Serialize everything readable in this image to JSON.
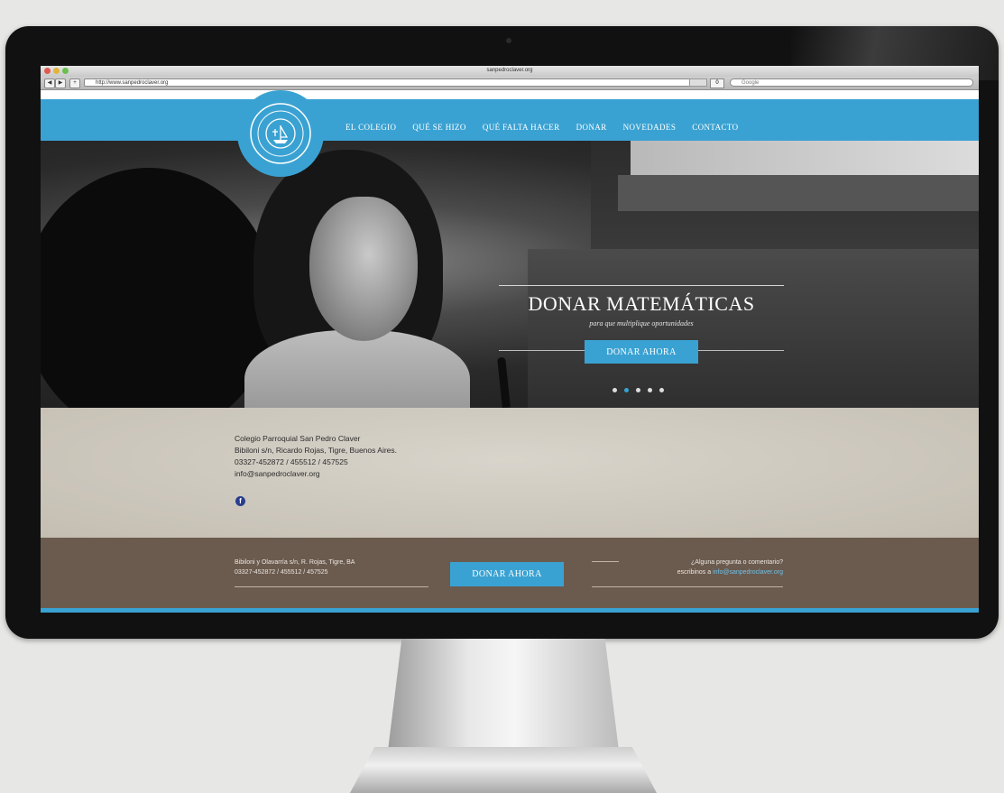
{
  "browser": {
    "window_title": "sanpedroclaver.org",
    "url": "http://www.sanpedroclaver.org",
    "reader_count": "0",
    "search_placeholder": "Google",
    "back_label": "◀",
    "fwd_label": "▶",
    "add_label": "+"
  },
  "nav": {
    "items": [
      "EL COLEGIO",
      "QUÉ SE HIZO",
      "QUÉ FALTA HACER",
      "DONAR",
      "NOVEDADES",
      "CONTACTO"
    ]
  },
  "hero": {
    "title": "DONAR MATEMÁTICAS",
    "subtitle": "para que multiplique oportunidades",
    "button": "DONAR AHORA",
    "slides_total": 5,
    "active_slide": 2
  },
  "contact": {
    "name": "Colegio Parroquial San Pedro Claver",
    "address": "Bibiloni s/n, Ricardo Rojas, Tigre, Buenos Aires.",
    "phones": "03327-452872 / 455512 / 457525",
    "email": "info@sanpedroclaver.org",
    "facebook_label": "f"
  },
  "footer": {
    "address": "Bibiloni y Olavarría s/n, R. Rojas, Tigre, BA",
    "phones": "03327-452872 / 455512 / 457525",
    "button": "DONAR AHORA",
    "question": "¿Alguna pregunta o comentario?",
    "write_prefix": "escribinos a ",
    "email": "info@sanpedroclaver.org"
  },
  "colors": {
    "accent": "#3aa2d2",
    "footer": "#6b5b4f",
    "paper": "#cdc7bb"
  },
  "icons": [
    "facebook-icon",
    "logo-emblem",
    "close-window",
    "minimize-window",
    "zoom-window"
  ]
}
